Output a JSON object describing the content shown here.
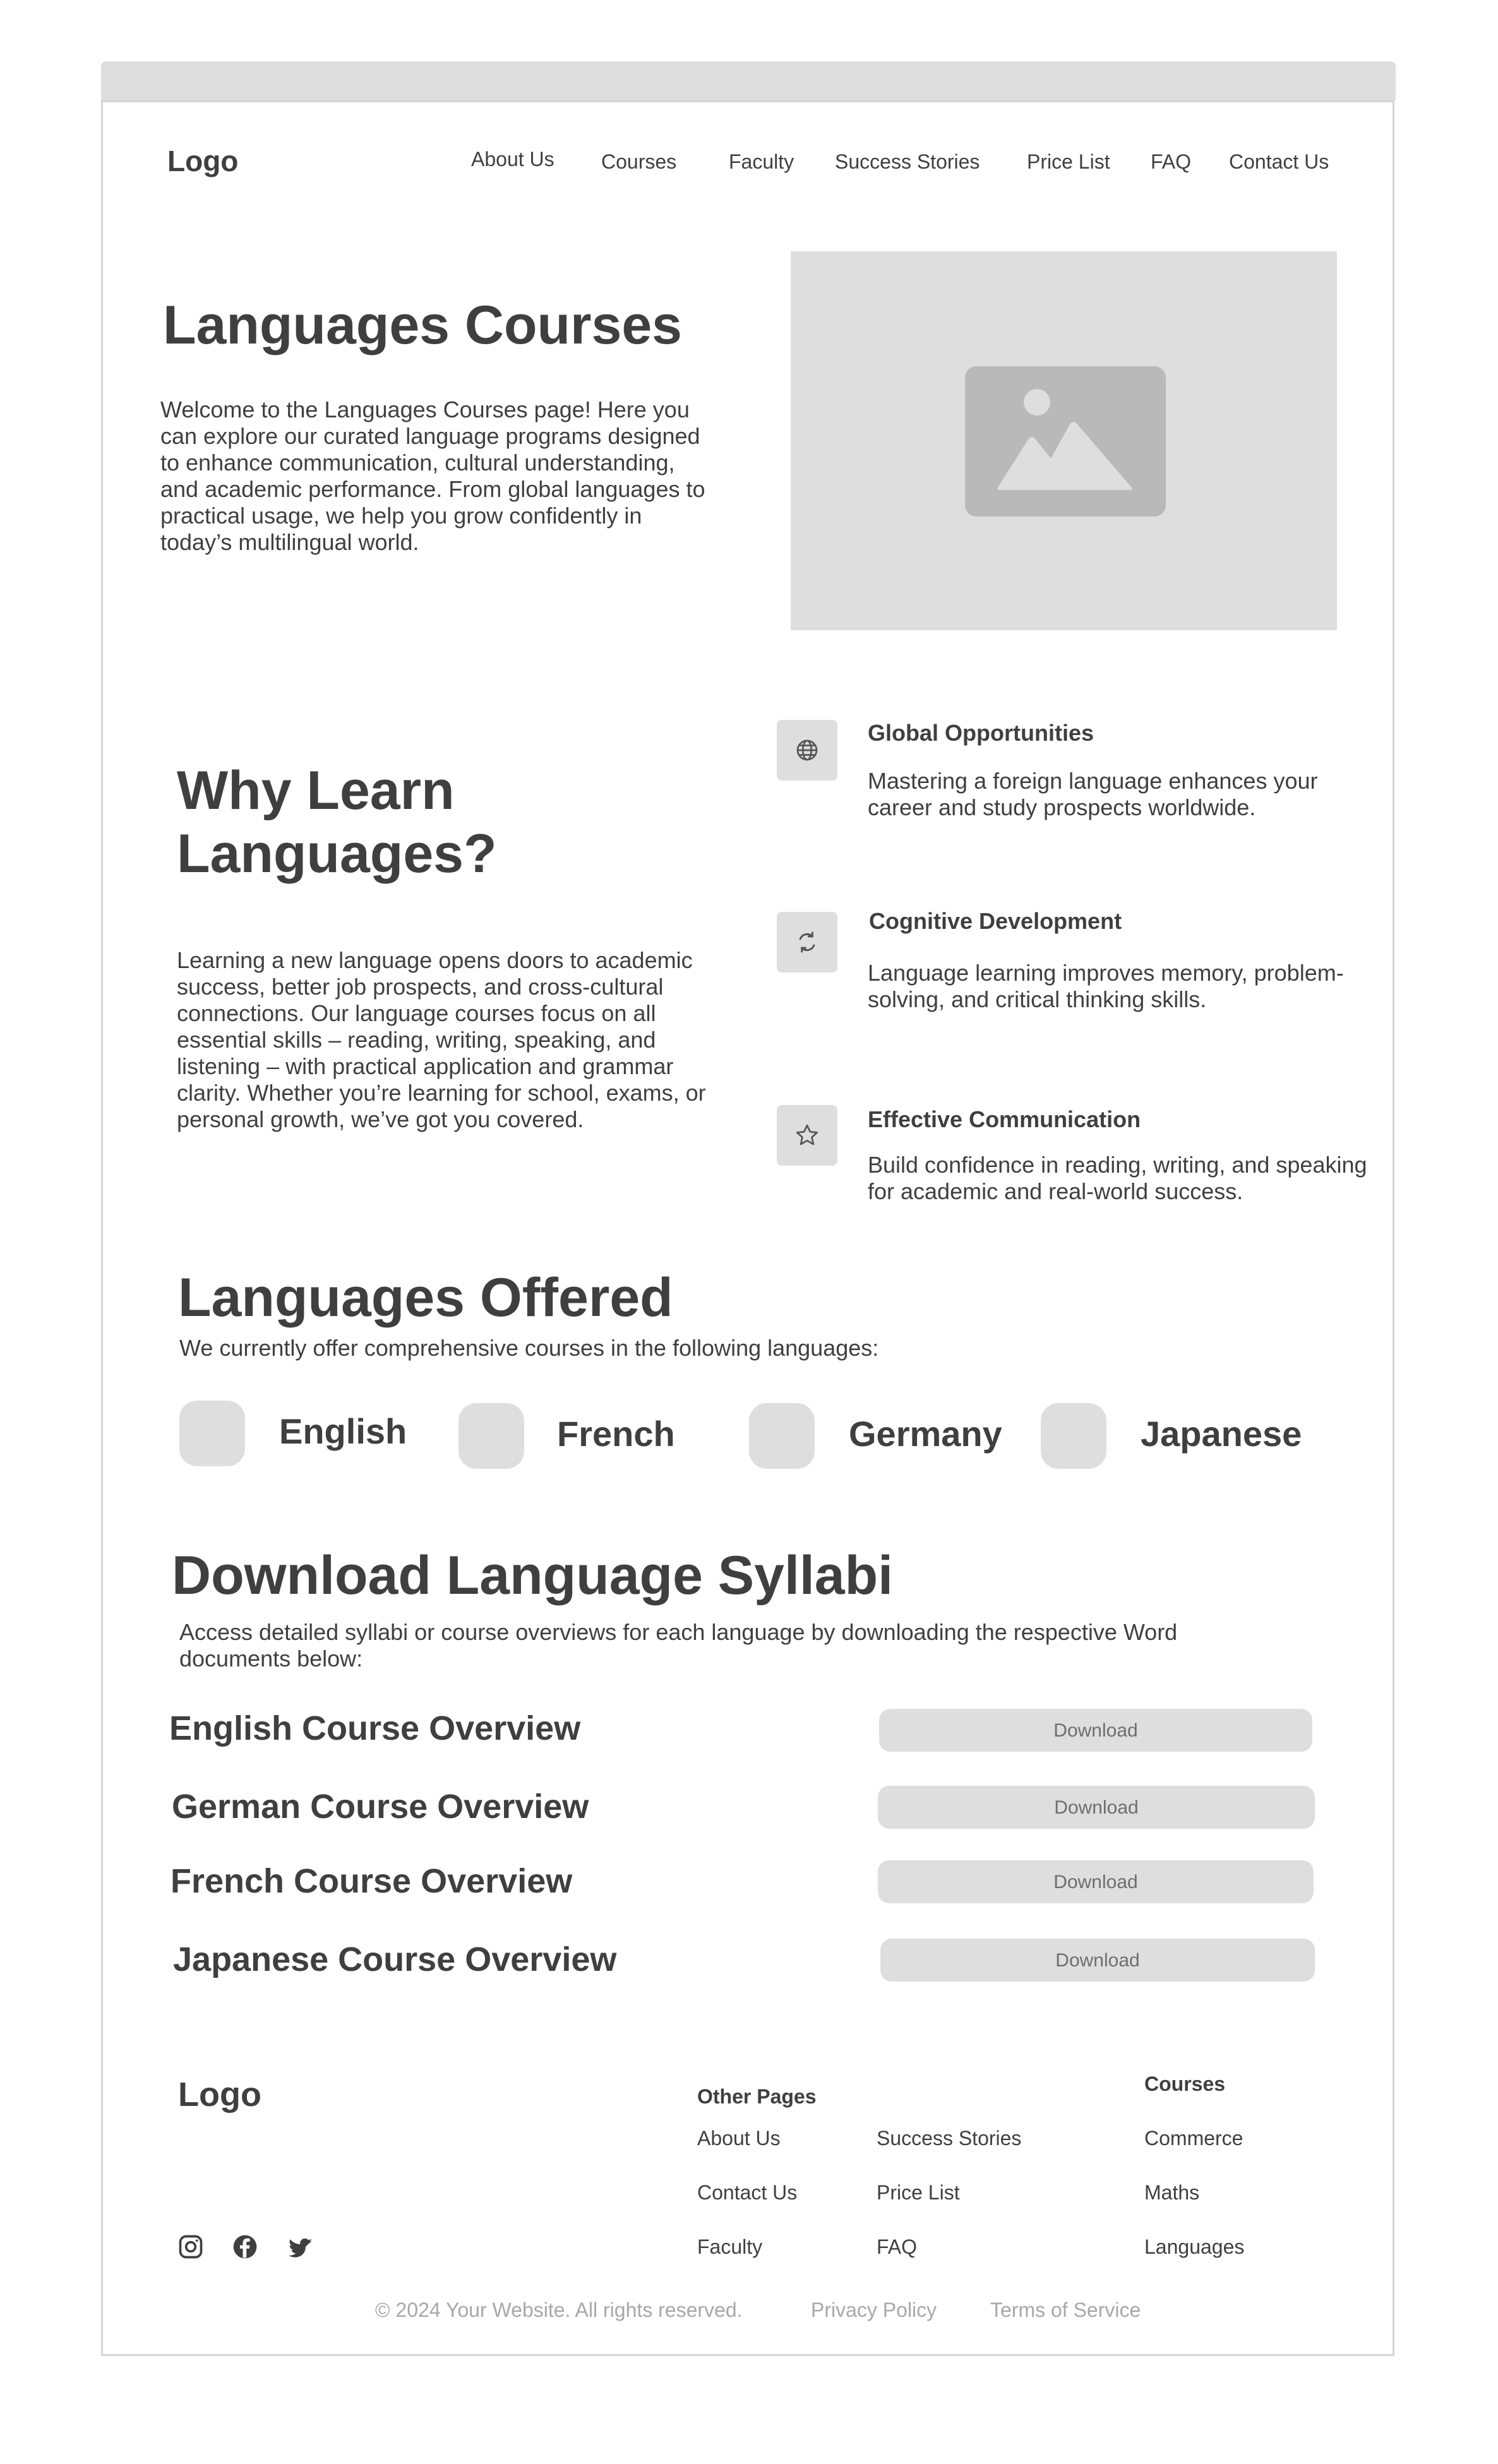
{
  "header": {
    "logo": "Logo",
    "nav": [
      "About Us",
      "Courses",
      "Faculty",
      "Success Stories",
      "Price List",
      "FAQ",
      "Contact Us"
    ]
  },
  "hero": {
    "title": "Languages Courses",
    "description": "Welcome to the Languages Courses page! Here you can explore our curated language programs designed to enhance communication, cultural understanding, and academic performance. From global languages to practical usage, we help you grow confidently in today’s multilingual world.",
    "image_icon": "image-placeholder-icon"
  },
  "why": {
    "title": "Why Learn Languages?",
    "description": "Learning a new language opens doors to academic success, better job prospects, and cross-cultural connections. Our language courses focus on all essential skills – reading, writing, speaking, and listening – with practical application and grammar clarity. Whether you’re learning for school, exams, or personal growth, we’ve got you covered.",
    "features": [
      {
        "icon": "globe-icon",
        "title": "Global Opportunities",
        "description": "Mastering a foreign language enhances your career and study prospects worldwide."
      },
      {
        "icon": "refresh-icon",
        "title": "Cognitive Development",
        "description": "Language learning improves memory, problem-solving, and critical thinking skills."
      },
      {
        "icon": "star-icon",
        "title": "Effective Communication",
        "description": "Build confidence in reading, writing, and speaking for academic and real-world success."
      }
    ]
  },
  "offered": {
    "title": "Languages Offered",
    "subtitle": "We currently offer comprehensive courses in the following languages:",
    "languages": [
      "English",
      "French",
      "Germany",
      "Japanese"
    ]
  },
  "syllabi": {
    "title": "Download Language Syllabi",
    "subtitle": "Access detailed syllabi or course overviews for each language by downloading the respective Word documents below:",
    "items": [
      {
        "name": "English Course Overview",
        "button": "Download"
      },
      {
        "name": "German Course Overview",
        "button": "Download"
      },
      {
        "name": "French Course Overview",
        "button": "Download"
      },
      {
        "name": "Japanese Course Overview",
        "button": "Download"
      }
    ]
  },
  "footer": {
    "logo": "Logo",
    "other_pages_heading": "Other Pages",
    "other_pages": [
      "About Us",
      "Contact Us",
      "Faculty",
      "Success Stories",
      "Price List",
      "FAQ"
    ],
    "courses_heading": "Courses",
    "courses": [
      "Commerce",
      "Maths",
      "Languages"
    ],
    "social_icons": [
      "instagram-icon",
      "facebook-icon",
      "twitter-icon"
    ],
    "copyright": "© 2024 Your Website. All rights reserved.",
    "privacy": "Privacy Policy",
    "terms": "Terms of Service"
  },
  "colors": {
    "text": "#3f3f3f",
    "placeholder": "#dedede",
    "muted": "#a8a8a8"
  }
}
